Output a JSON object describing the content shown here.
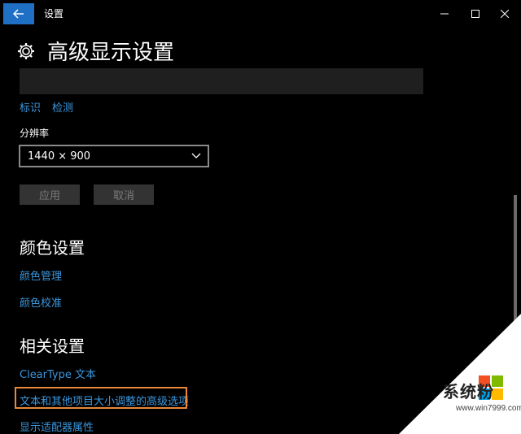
{
  "window": {
    "title": "设置"
  },
  "page": {
    "title": "高级显示设置"
  },
  "display": {
    "links": [
      "标识",
      "检测"
    ],
    "resolution_label": "分辨率",
    "resolution_value": "1440 × 900",
    "apply_label": "应用",
    "cancel_label": "取消"
  },
  "color": {
    "title": "颜色设置",
    "links": [
      "颜色管理",
      "颜色校准"
    ]
  },
  "related": {
    "title": "相关设置",
    "links": [
      "ClearType 文本",
      "文本和其他项目大小调整的高级选项",
      "显示适配器属性"
    ]
  },
  "watermark": {
    "brand": "系统粉",
    "url": "www.win7999.com"
  },
  "colors": {
    "accent": "#1f6fc5",
    "link": "#3a96dd",
    "highlight": "#e8893a"
  }
}
